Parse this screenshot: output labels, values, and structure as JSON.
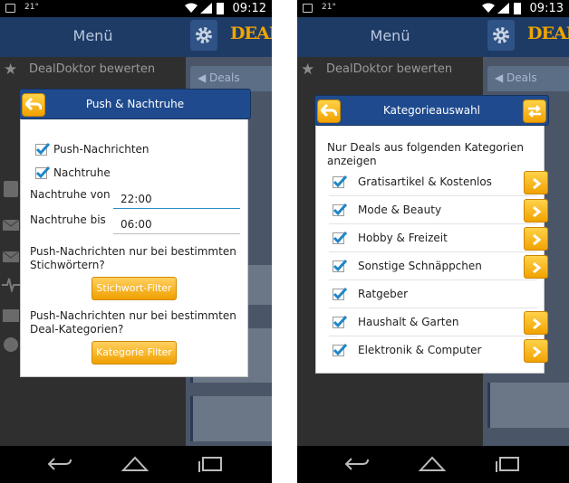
{
  "status_bar": {
    "temperature": "21°",
    "time_left": "09:12",
    "time_right": "09:13"
  },
  "app": {
    "menu_title": "Menü",
    "logo_text": "DEAL",
    "side_top_item": "DealDoktor bewerten",
    "deals_tab": "Deals"
  },
  "push_dialog": {
    "title": "Push & Nachtruhe",
    "push_notifications_label": "Push-Nachrichten",
    "push_notifications_checked": true,
    "night_rest_label": "Nachtruhe",
    "night_rest_checked": true,
    "night_from_label": "Nachtruhe von",
    "night_from_value": "22:00",
    "night_to_label": "Nachtruhe bis",
    "night_to_value": "06:00",
    "keyword_text": "Push-Nachrichten nur bei bestimmten Stichwörtern?",
    "keyword_button": "Stichwort-Filter",
    "category_text": "Push-Nachrichten nur bei bestimmten Deal-Kategorien?",
    "category_button": "Kategorie Filter"
  },
  "category_dialog": {
    "title": "Kategorieauswahl",
    "intro": "Nur Deals aus folgenden Kategorien anzeigen",
    "categories": [
      {
        "label": "Gratisartikel & Kostenlos",
        "checked": true,
        "has_arrow": true
      },
      {
        "label": "Mode & Beauty",
        "checked": true,
        "has_arrow": true
      },
      {
        "label": "Hobby & Freizeit",
        "checked": true,
        "has_arrow": true
      },
      {
        "label": "Sonstige Schnäppchen",
        "checked": true,
        "has_arrow": true
      },
      {
        "label": "Ratgeber",
        "checked": true,
        "has_arrow": false
      },
      {
        "label": "Haushalt & Garten",
        "checked": true,
        "has_arrow": true
      },
      {
        "label": "Elektronik & Computer",
        "checked": true,
        "has_arrow": true
      }
    ]
  },
  "colors": {
    "header_blue": "#1f4b8e",
    "accent_orange": "#f2a200",
    "check_blue": "#1f86c8",
    "app_bar": "#1e3b66"
  }
}
